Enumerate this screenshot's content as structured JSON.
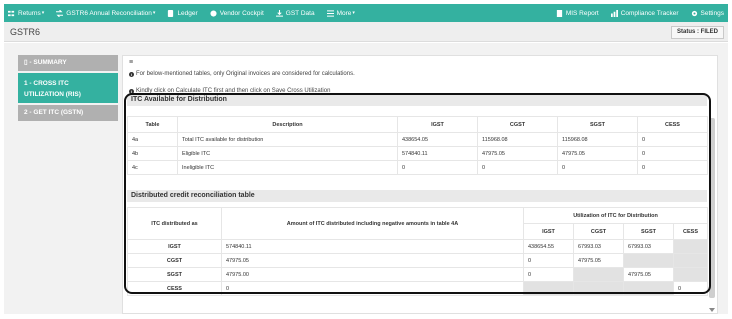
{
  "nav": {
    "left": [
      {
        "label": "Returns",
        "icon": "returns-icon",
        "caret": true
      },
      {
        "label": "GSTR6 Annual Reconciliation",
        "icon": "reconciliation-icon",
        "caret": true
      },
      {
        "label": "Ledger",
        "icon": "ledger-icon",
        "caret": false
      },
      {
        "label": "Vendor Cockpit",
        "icon": "vendor-icon",
        "caret": false
      },
      {
        "label": "GST Data",
        "icon": "data-icon",
        "caret": false
      },
      {
        "label": "More",
        "icon": "more-icon",
        "caret": true
      }
    ],
    "right": [
      {
        "label": "MIS Report",
        "icon": "report-icon"
      },
      {
        "label": "Compliance Tracker",
        "icon": "tracker-icon"
      },
      {
        "label": "Settings",
        "icon": "gear-icon"
      }
    ]
  },
  "page": {
    "title": "GSTR6",
    "status": "Status : FILED"
  },
  "sidebar": {
    "summary": "- SUMMARY",
    "cross_line1": "1 - CROSS ITC",
    "cross_line2": "UTILIZATION (RIS)",
    "get_itc": "2 - GET ITC (GSTN)"
  },
  "main": {
    "menu_icon": "≡",
    "note1": "For below-mentioned tables, only Original invoices are considered for calculations.",
    "note2": "Kindly click on Calculate ITC first and then click on Save Cross Utilization"
  },
  "itc_available": {
    "title": "ITC Available for Distribution",
    "headers": [
      "Table",
      "Description",
      "IGST",
      "CGST",
      "SGST",
      "CESS"
    ],
    "rows": [
      [
        "4a",
        "Total ITC available for distribution",
        "438654.05",
        "115968.08",
        "115968.08",
        "0"
      ],
      [
        "4b",
        "Eligible ITC",
        "574840.11",
        "47975.05",
        "47975.05",
        "0"
      ],
      [
        "4c",
        "Ineligible ITC",
        "0",
        "0",
        "0",
        "0"
      ]
    ]
  },
  "distributed": {
    "title": "Distributed credit reconciliation table",
    "h_col1": "ITC distributed as",
    "h_col2": "Amount of ITC distributed including negative amounts in table 4A",
    "h_util": "Utilization of ITC for Distribution",
    "sub": [
      "IGST",
      "CGST",
      "SGST",
      "CESS"
    ],
    "rows": [
      {
        "label": "IGST",
        "amount": "574840.11",
        "igst": "438654.55",
        "cgst": "67993.03",
        "sgst": "67993.03",
        "cess": ""
      },
      {
        "label": "CGST",
        "amount": "47975.05",
        "igst": "0",
        "cgst": "47975.05",
        "sgst": "",
        "cess": ""
      },
      {
        "label": "SGST",
        "amount": "47975.00",
        "igst": "0",
        "cgst": "",
        "sgst": "47975.05",
        "cess": ""
      },
      {
        "label": "CESS",
        "amount": "0",
        "igst": "",
        "cgst": "",
        "sgst": "",
        "cess": "0"
      }
    ]
  },
  "colors": {
    "accent": "#34b1a0",
    "inactive": "#b0b0b0"
  }
}
